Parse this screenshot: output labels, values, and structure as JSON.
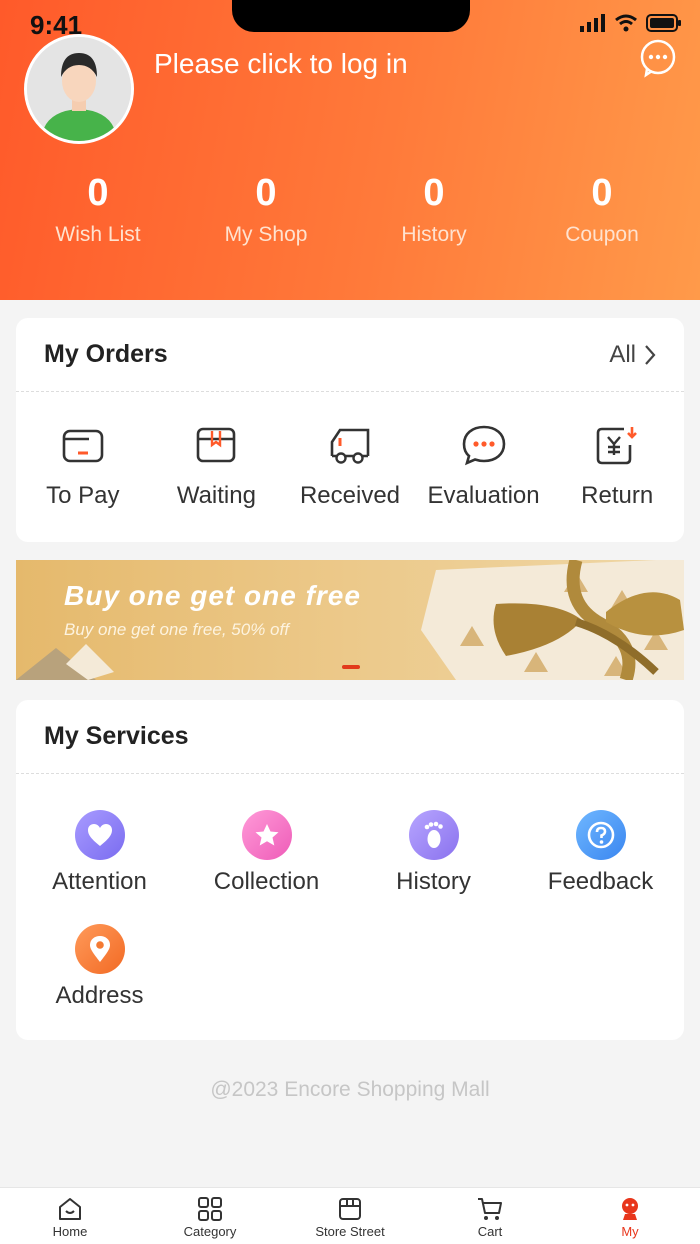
{
  "status_bar": {
    "time": "9:41"
  },
  "profile": {
    "login_prompt": "Please click to log in"
  },
  "stats": [
    {
      "value": "0",
      "label": "Wish List"
    },
    {
      "value": "0",
      "label": "My Shop"
    },
    {
      "value": "0",
      "label": "History"
    },
    {
      "value": "0",
      "label": "Coupon"
    }
  ],
  "orders": {
    "title": "My Orders",
    "all_label": "All",
    "items": [
      {
        "label": "To Pay",
        "icon": "wallet-icon"
      },
      {
        "label": "Waiting",
        "icon": "package-icon"
      },
      {
        "label": "Received",
        "icon": "truck-icon"
      },
      {
        "label": "Evaluation",
        "icon": "chat-icon"
      },
      {
        "label": "Return",
        "icon": "refund-icon"
      }
    ]
  },
  "banner": {
    "title": "Buy one get one free",
    "subtitle": "Buy one get one free, 50% off"
  },
  "services": {
    "title": "My Services",
    "items": [
      {
        "label": "Attention",
        "icon": "heart-icon",
        "color": "#8b7cf6"
      },
      {
        "label": "Collection",
        "icon": "star-icon",
        "color": "#f06fc1"
      },
      {
        "label": "History",
        "icon": "footprint-icon",
        "color": "#9b85f0"
      },
      {
        "label": "Feedback",
        "icon": "question-icon",
        "color": "#4a9cf5"
      },
      {
        "label": "Address",
        "icon": "location-pin-icon",
        "color": "#f7742f"
      }
    ]
  },
  "footer": {
    "copyright": "@2023 Encore Shopping Mall"
  },
  "tabbar": {
    "items": [
      {
        "label": "Home",
        "icon": "home-icon"
      },
      {
        "label": "Category",
        "icon": "grid-icon"
      },
      {
        "label": "Store Street",
        "icon": "store-icon"
      },
      {
        "label": "Cart",
        "icon": "cart-icon"
      },
      {
        "label": "My",
        "icon": "user-icon",
        "active": true
      }
    ]
  },
  "colors": {
    "header_start": "#ff5a2a",
    "header_end": "#ff9a4a",
    "accent": "#e8361c"
  }
}
